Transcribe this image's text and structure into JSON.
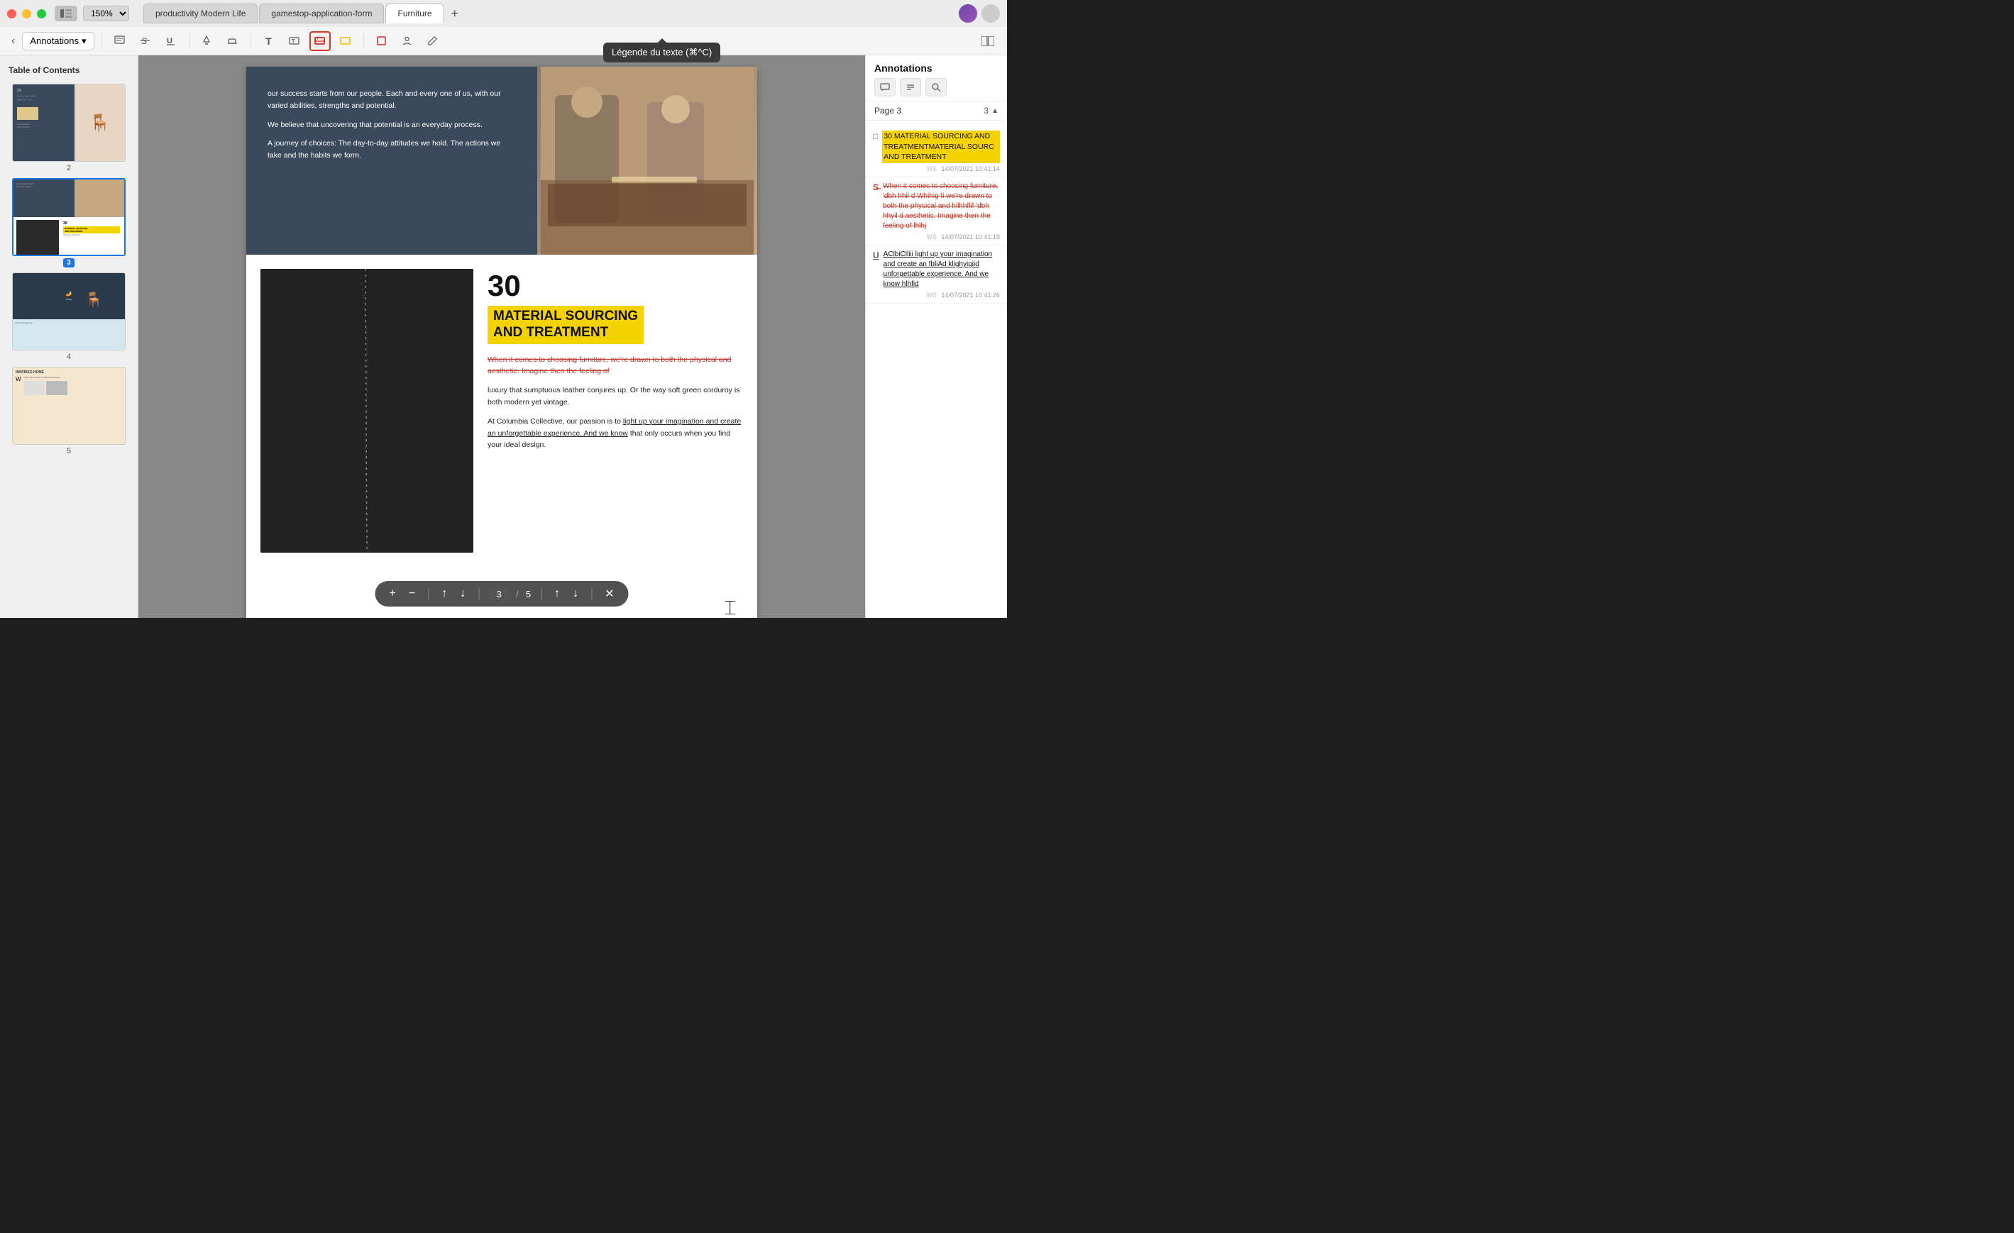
{
  "titlebar": {
    "zoom": "150%",
    "tabs": [
      {
        "label": "productivity Modern Life",
        "active": false
      },
      {
        "label": "gamestop-application-form",
        "active": false
      },
      {
        "label": "Furniture",
        "active": true
      }
    ],
    "add_tab_label": "+"
  },
  "toolbar": {
    "back_label": "‹",
    "annotations_label": "Annotations",
    "dropdown_arrow": "▾",
    "tooltip": "Légende du texte (⌘^C)"
  },
  "sidebar": {
    "title": "Table of Contents",
    "pages": [
      {
        "num": "2"
      },
      {
        "num": "3",
        "active": true
      },
      {
        "num": "4"
      },
      {
        "num": "5"
      }
    ]
  },
  "page": {
    "top_text1": "our success starts from our people. Each and every one of us, with our varied abilities, strengths and potential.",
    "top_text2": "We believe that uncovering that potential is an everyday process.",
    "top_text3": "A journey of choices: The day-to-day attitudes we hold. The actions we take and the habits we form.",
    "number": "30",
    "heading_line1": "MATERIAL SOURCING",
    "heading_line2": "AND TREATMENT",
    "body_strikethrough": "When it comes to choosing furniture, we're drawn to both the physical and aesthetic. Imagine then the feeling of",
    "body_text1": "luxury that sumptuous leather conjures up. Or the way soft green corduroy is both modern yet vintage.",
    "body_text2": "At Columbia Collective, our passion is to",
    "body_underline": "light up your imagination and create an unforgettable experience. And we know",
    "body_text3": "that only occurs when you find your ideal design."
  },
  "annotations": {
    "title": "Annotations",
    "page_label": "Page 3",
    "page_count": "3",
    "items": [
      {
        "type": "highlight",
        "icon": "□",
        "text": "30 MATERIAL SOURCING AND TREATMENTMATERIAL SOURC AND TREATMENT",
        "ws": "WS",
        "date": "14/07/2021 10:41:14"
      },
      {
        "type": "strikethrough",
        "icon": "S̶",
        "text": "When it comes to choosing furniture, 'dbh hhil d Whihig fi we're drawn to both the physical and hilhhflif 'dbh hhyil d aesthetic. Imagine then the feeling of lhlhj",
        "ws": "WS",
        "date": "14/07/2021 10:41:19"
      },
      {
        "type": "underline",
        "icon": "U̲",
        "text": "AClbiClliii light up your imagination and create an fbliAd klighyigiid unforgettable experience. And we know hlhfid",
        "ws": "WS",
        "date": "14/07/2021 10:41:26"
      }
    ]
  },
  "nav": {
    "current_page": "3",
    "total_pages": "5"
  }
}
